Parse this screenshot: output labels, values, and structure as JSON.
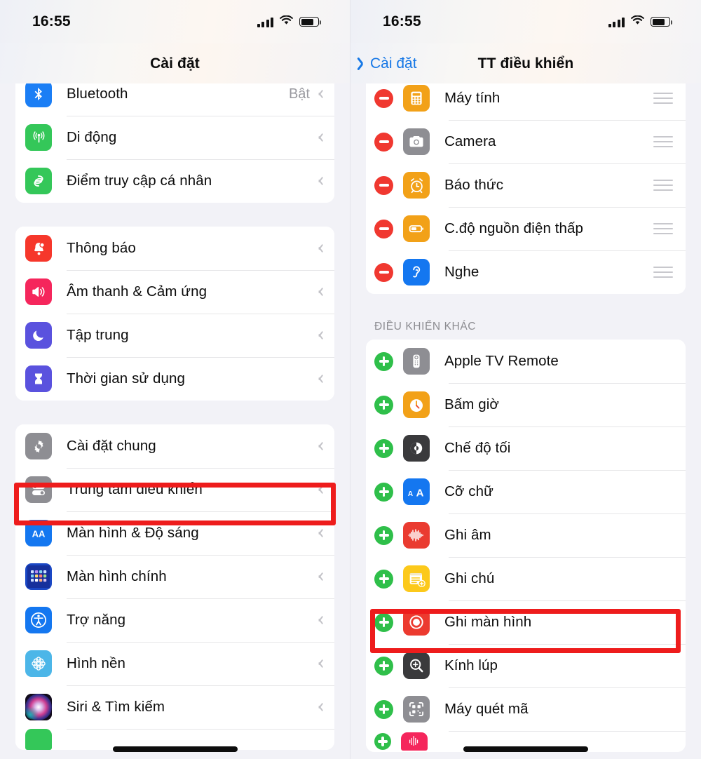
{
  "left": {
    "status": {
      "time": "16:55",
      "signal_icon": "cellular-signal-icon",
      "wifi_icon": "wifi-icon",
      "battery_icon": "battery-icon"
    },
    "nav": {
      "title": "Cài đặt"
    },
    "groups": [
      {
        "id": "connectivity",
        "rows": [
          {
            "label": "Bluetooth",
            "value": "Bật",
            "icon": "bluetooth-icon"
          },
          {
            "label": "Di động",
            "value": "",
            "icon": "cellular-icon"
          },
          {
            "label": "Điểm truy cập cá nhân",
            "value": "",
            "icon": "personal-hotspot-icon"
          }
        ]
      },
      {
        "id": "notifications",
        "rows": [
          {
            "label": "Thông báo",
            "value": "",
            "icon": "notifications-icon"
          },
          {
            "label": "Âm thanh & Cảm ứng",
            "value": "",
            "icon": "sounds-haptics-icon"
          },
          {
            "label": "Tập trung",
            "value": "",
            "icon": "focus-icon"
          },
          {
            "label": "Thời gian sử dụng",
            "value": "",
            "icon": "screen-time-icon"
          }
        ]
      },
      {
        "id": "system",
        "rows": [
          {
            "label": "Cài đặt chung",
            "value": "",
            "icon": "general-gear-icon"
          },
          {
            "label": "Trung tâm điều khiển",
            "value": "",
            "icon": "control-center-icon",
            "highlighted": true
          },
          {
            "label": "Màn hình & Độ sáng",
            "value": "",
            "icon": "display-brightness-icon"
          },
          {
            "label": "Màn hình chính",
            "value": "",
            "icon": "home-screen-icon"
          },
          {
            "label": "Trợ năng",
            "value": "",
            "icon": "accessibility-icon"
          },
          {
            "label": "Hình nền",
            "value": "",
            "icon": "wallpaper-icon"
          },
          {
            "label": "Siri & Tìm kiếm",
            "value": "",
            "icon": "siri-search-icon"
          }
        ]
      }
    ]
  },
  "right": {
    "status": {
      "time": "16:55",
      "signal_icon": "cellular-signal-icon",
      "wifi_icon": "wifi-icon",
      "battery_icon": "battery-icon"
    },
    "nav": {
      "back_label": "Cài đặt",
      "back_icon": "chevron-left-icon",
      "title": "TT điều khiển"
    },
    "included": {
      "rows": [
        {
          "label": "Máy tính",
          "icon": "calculator-icon",
          "action": "remove",
          "handle": "reorder-handle-icon"
        },
        {
          "label": "Camera",
          "icon": "camera-icon",
          "action": "remove",
          "handle": "reorder-handle-icon"
        },
        {
          "label": "Báo thức",
          "icon": "alarm-clock-icon",
          "action": "remove",
          "handle": "reorder-handle-icon"
        },
        {
          "label": "C.độ nguồn điện thấp",
          "icon": "low-power-mode-icon",
          "action": "remove",
          "handle": "reorder-handle-icon"
        },
        {
          "label": "Nghe",
          "icon": "hearing-icon",
          "action": "remove",
          "handle": "reorder-handle-icon"
        }
      ]
    },
    "more_section": {
      "header": "ĐIỀU KHIỂN KHÁC",
      "rows": [
        {
          "label": "Apple TV Remote",
          "icon": "apple-tv-remote-icon",
          "action": "add"
        },
        {
          "label": "Bấm giờ",
          "icon": "stopwatch-icon",
          "action": "add"
        },
        {
          "label": "Chế độ tối",
          "icon": "dark-mode-icon",
          "action": "add"
        },
        {
          "label": "Cỡ chữ",
          "icon": "text-size-icon",
          "action": "add"
        },
        {
          "label": "Ghi âm",
          "icon": "voice-memos-icon",
          "action": "add"
        },
        {
          "label": "Ghi chú",
          "icon": "notes-icon",
          "action": "add"
        },
        {
          "label": "Ghi màn hình",
          "icon": "screen-recording-icon",
          "action": "add",
          "highlighted": true
        },
        {
          "label": "Kính lúp",
          "icon": "magnifier-icon",
          "action": "add"
        },
        {
          "label": "Máy quét mã",
          "icon": "code-scanner-icon",
          "action": "add"
        },
        {
          "label": "",
          "icon": "sound-recognition-icon",
          "action": "add"
        }
      ]
    }
  },
  "colors": {
    "highlight": "#ee1c1c",
    "accent_blue": "#1577e6",
    "remove_red": "#f03830",
    "add_green": "#2fbf4a",
    "page_bg": "#f2f2f7"
  }
}
